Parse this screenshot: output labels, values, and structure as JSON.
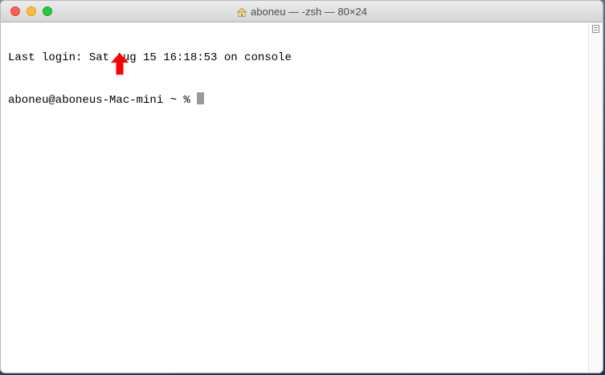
{
  "window": {
    "title": "aboneu — -zsh — 80×24",
    "title_icon": "home-folder-icon"
  },
  "terminal": {
    "lines": [
      "Last login: Sat Aug 15 16:18:53 on console",
      "aboneu@aboneus-Mac-mini ~ % "
    ]
  },
  "annotation": {
    "icon": "red-arrow-up-icon",
    "color": "#ff0000"
  },
  "colors": {
    "close": "#fe5f57",
    "minimize": "#febc2e",
    "zoom": "#28c840"
  }
}
